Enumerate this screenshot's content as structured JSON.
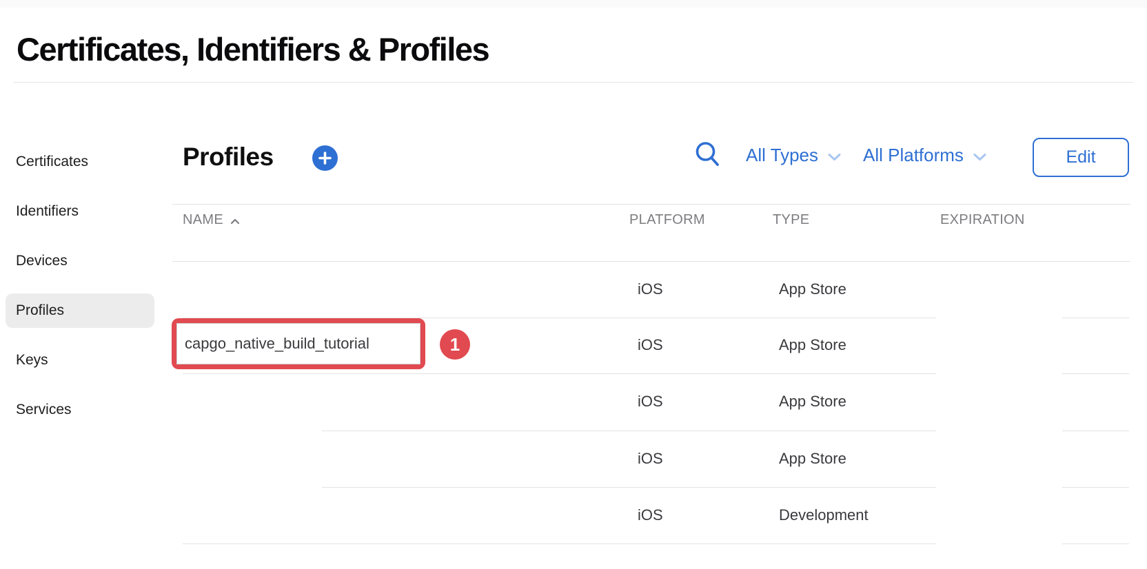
{
  "page": {
    "title": "Certificates, Identifiers & Profiles"
  },
  "sidebar": {
    "items": [
      {
        "label": "Certificates",
        "selected": false
      },
      {
        "label": "Identifiers",
        "selected": false
      },
      {
        "label": "Devices",
        "selected": false
      },
      {
        "label": "Profiles",
        "selected": true
      },
      {
        "label": "Keys",
        "selected": false
      },
      {
        "label": "Services",
        "selected": false
      }
    ]
  },
  "toolbar": {
    "heading": "Profiles",
    "add_icon": "plus-in-blue-circle",
    "search_icon": "magnifying-glass",
    "type_filter": {
      "label": "All Types",
      "icon": "chevron-down"
    },
    "platform_filter": {
      "label": "All Platforms",
      "icon": "chevron-down"
    },
    "edit_label": "Edit"
  },
  "table": {
    "headers": {
      "name": "NAME",
      "platform": "PLATFORM",
      "type": "TYPE",
      "expiration": "EXPIRATION"
    },
    "sort": {
      "column": "NAME",
      "direction": "ascending",
      "icon": "chevron-up"
    },
    "rows": [
      {
        "name": "",
        "platform": "iOS",
        "type": "App Store",
        "expiration": ""
      },
      {
        "name": "capgo_native_build_tutorial",
        "platform": "iOS",
        "type": "App Store",
        "expiration": ""
      },
      {
        "name": "",
        "platform": "iOS",
        "type": "App Store",
        "expiration": ""
      },
      {
        "name": "",
        "platform": "iOS",
        "type": "App Store",
        "expiration": ""
      },
      {
        "name": "",
        "platform": "iOS",
        "type": "Development",
        "expiration": ""
      }
    ]
  },
  "annotation": {
    "step_number": "1"
  },
  "colors": {
    "accent_blue": "#2e6fd3",
    "chevron_light_blue": "#a9c6f0",
    "annotation_red": "#e14a50",
    "selected_item_bg": "#ececec",
    "divider": "#e2e2e2",
    "header_text": "#7c7c80",
    "body_text": "#3a3a3e"
  }
}
